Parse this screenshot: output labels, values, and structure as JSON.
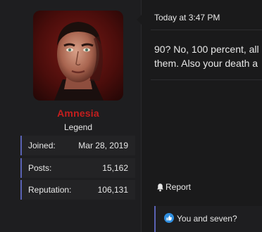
{
  "user": {
    "username": "Amnesia",
    "title": "Legend",
    "username_color": "#c41e1e",
    "stats": [
      {
        "label": "Joined:",
        "value": "Mar 28, 2019"
      },
      {
        "label": "Posts:",
        "value": "15,162"
      },
      {
        "label": "Reputation:",
        "value": "106,131"
      }
    ]
  },
  "post": {
    "timestamp": "Today at 3:47 PM",
    "lines": [
      "90? No, 100 percent, all",
      "them. Also your death a"
    ]
  },
  "actions": {
    "report_label": "Report",
    "report_icon": "bell-icon"
  },
  "reactions": {
    "icon": "like-icon",
    "text": "You and seven?"
  },
  "colors": {
    "accent": "#5a62b4",
    "background": "#1a1a1b",
    "panel": "#1e1e20",
    "text": "#e8e8e8"
  }
}
